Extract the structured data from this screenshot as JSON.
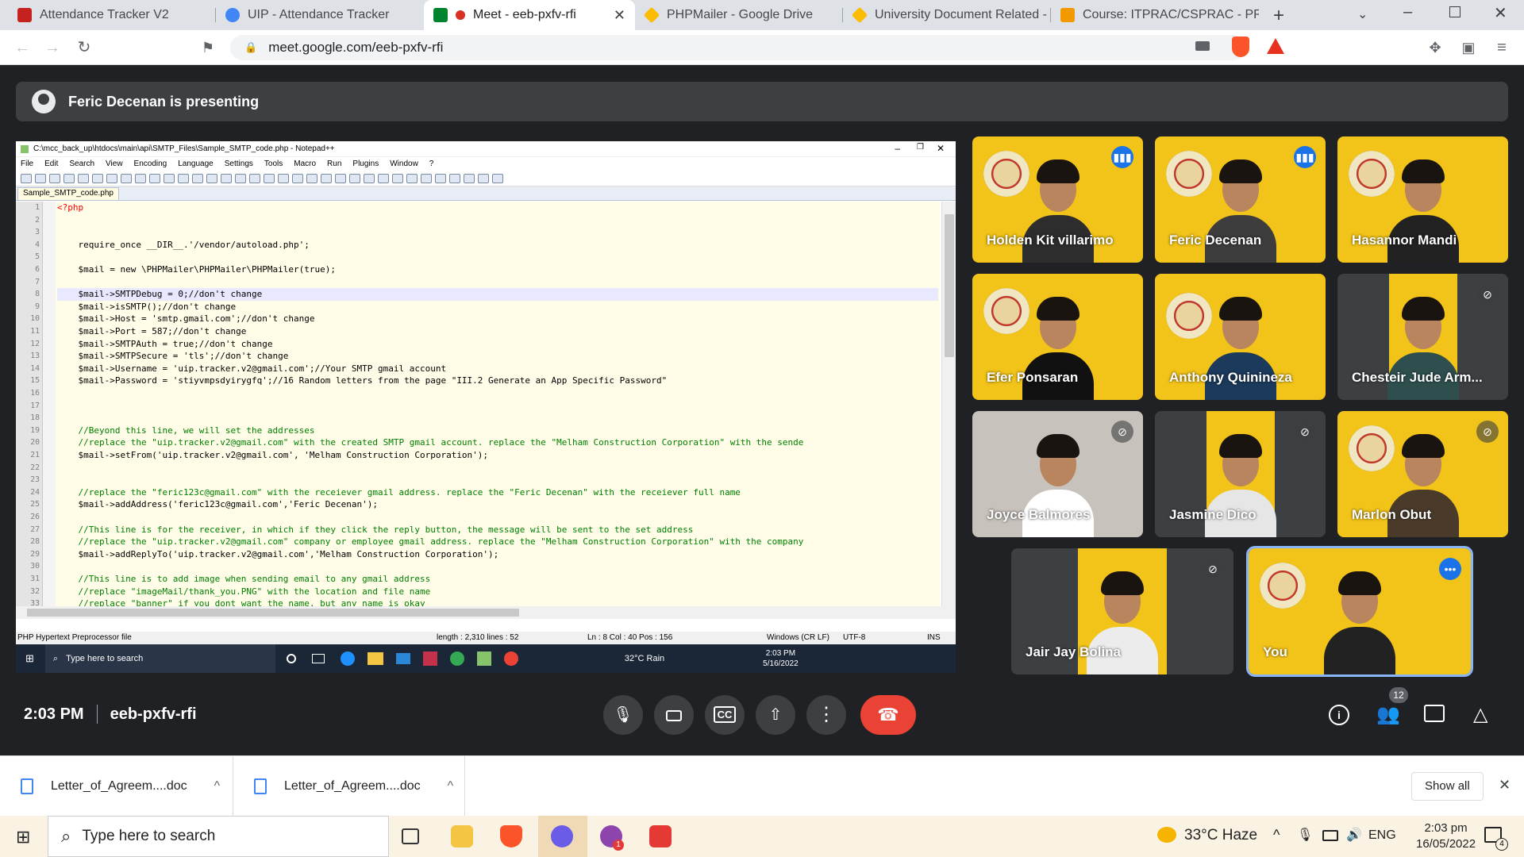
{
  "browser": {
    "tabs": [
      {
        "title": "Attendance Tracker V2",
        "color": "#c5221f"
      },
      {
        "title": "UIP - Attendance Tracker",
        "color": "#4285f4"
      },
      {
        "title": "Meet - eeb-pxfv-rfi",
        "color": "#00832d"
      },
      {
        "title": "PHPMailer - Google Drive",
        "color": "#fbbc04"
      },
      {
        "title": "University Document Related - G",
        "color": "#fbbc04"
      },
      {
        "title": "Course: ITPRAC/CSPRAC - PRACT",
        "color": "#f29900"
      }
    ],
    "url": "meet.google.com/eeb-pxfv-rfi"
  },
  "meet": {
    "presenting_text": "Feric Decenan is presenting",
    "time": "2:03 PM",
    "meeting_code": "eeb-pxfv-rfi",
    "people_count": "12",
    "participants": [
      {
        "name": "Holden Kit villarimo",
        "status": "speaking"
      },
      {
        "name": "Feric Decenan",
        "status": "speaking"
      },
      {
        "name": "Hasannor Mandi",
        "status": "none"
      },
      {
        "name": "Efer Ponsaran",
        "status": "none"
      },
      {
        "name": "Anthony Quinineza",
        "status": "none"
      },
      {
        "name": "Chesteir Jude Arm...",
        "status": "muted"
      },
      {
        "name": "Joyce Balmores",
        "status": "muted"
      },
      {
        "name": "Jasmine Dico",
        "status": "muted"
      },
      {
        "name": "Marlon Obut",
        "status": "muted"
      },
      {
        "name": "Jair Jay Bolina",
        "status": "muted"
      },
      {
        "name": "You",
        "status": "more"
      }
    ]
  },
  "notepad": {
    "title": "C:\\mcc_back_up\\htdocs\\main\\api\\SMTP_Files\\Sample_SMTP_code.php - Notepad++",
    "menu": [
      "File",
      "Edit",
      "Search",
      "View",
      "Encoding",
      "Language",
      "Settings",
      "Tools",
      "Macro",
      "Run",
      "Plugins",
      "Window",
      "?"
    ],
    "tab": "Sample_SMTP_code.php",
    "lines": [
      "<?php",
      "",
      "",
      "    require_once __DIR__.'/vendor/autoload.php';",
      "",
      "    $mail = new \\PHPMailer\\PHPMailer\\PHPMailer(true);",
      "",
      "    $mail->SMTPDebug = 0;//don't change",
      "    $mail->isSMTP();//don't change",
      "    $mail->Host = 'smtp.gmail.com';//don't change",
      "    $mail->Port = 587;//don't change",
      "    $mail->SMTPAuth = true;//don't change",
      "    $mail->SMTPSecure = 'tls';//don't change",
      "    $mail->Username = 'uip.tracker.v2@gmail.com';//Your SMTP gmail account",
      "    $mail->Password = 'stiyvmpsdyirygfq';//16 Random letters from the page \"III.2 Generate an App Specific Password\"",
      "",
      "",
      "",
      "    //Beyond this line, we will set the addresses",
      "    //replace the \"uip.tracker.v2@gmail.com\" with the created SMTP gmail account. replace the \"Melham Construction Corporation\" with the sende",
      "    $mail->setFrom('uip.tracker.v2@gmail.com', 'Melham Construction Corporation');",
      "",
      "",
      "    //replace the \"feric123c@gmail.com\" with the receiever gmail address. replace the \"Feric Decenan\" with the receiever full name",
      "    $mail->addAddress('feric123c@gmail.com','Feric Decenan');",
      "",
      "    //This line is for the receiver, in which if they click the reply button, the message will be sent to the set address",
      "    //replace the \"uip.tracker.v2@gmail.com\" company or employee gmail address. replace the \"Melham Construction Corporation\" with the company",
      "    $mail->addReplyTo('uip.tracker.v2@gmail.com','Melham Construction Corporation');",
      "",
      "    //This line is to add image when sending email to any gmail address",
      "    //replace \"imageMail/thank_you.PNG\" with the location and file name",
      "    //replace \"banner\" if you dont want the name, but any name is okay"
    ],
    "status": {
      "type": "PHP Hypertext Preprocessor file",
      "length": "length : 2,310    lines : 52",
      "pos": "Ln : 8    Col : 40    Pos : 156",
      "eol": "Windows (CR LF)",
      "enc": "UTF-8",
      "ins": "INS"
    },
    "inner_taskbar": {
      "search": "Type here to search",
      "weather": "32°C  Rain",
      "time": "2:03 PM",
      "date": "5/16/2022"
    }
  },
  "downloads": {
    "items": [
      "Letter_of_Agreem....doc",
      "Letter_of_Agreem....doc"
    ],
    "show_all": "Show all"
  },
  "taskbar": {
    "search": "Type here to search",
    "weather": "33°C  Haze",
    "lang": "ENG",
    "time": "2:03 pm",
    "date": "16/05/2022",
    "notif_count": "4"
  }
}
